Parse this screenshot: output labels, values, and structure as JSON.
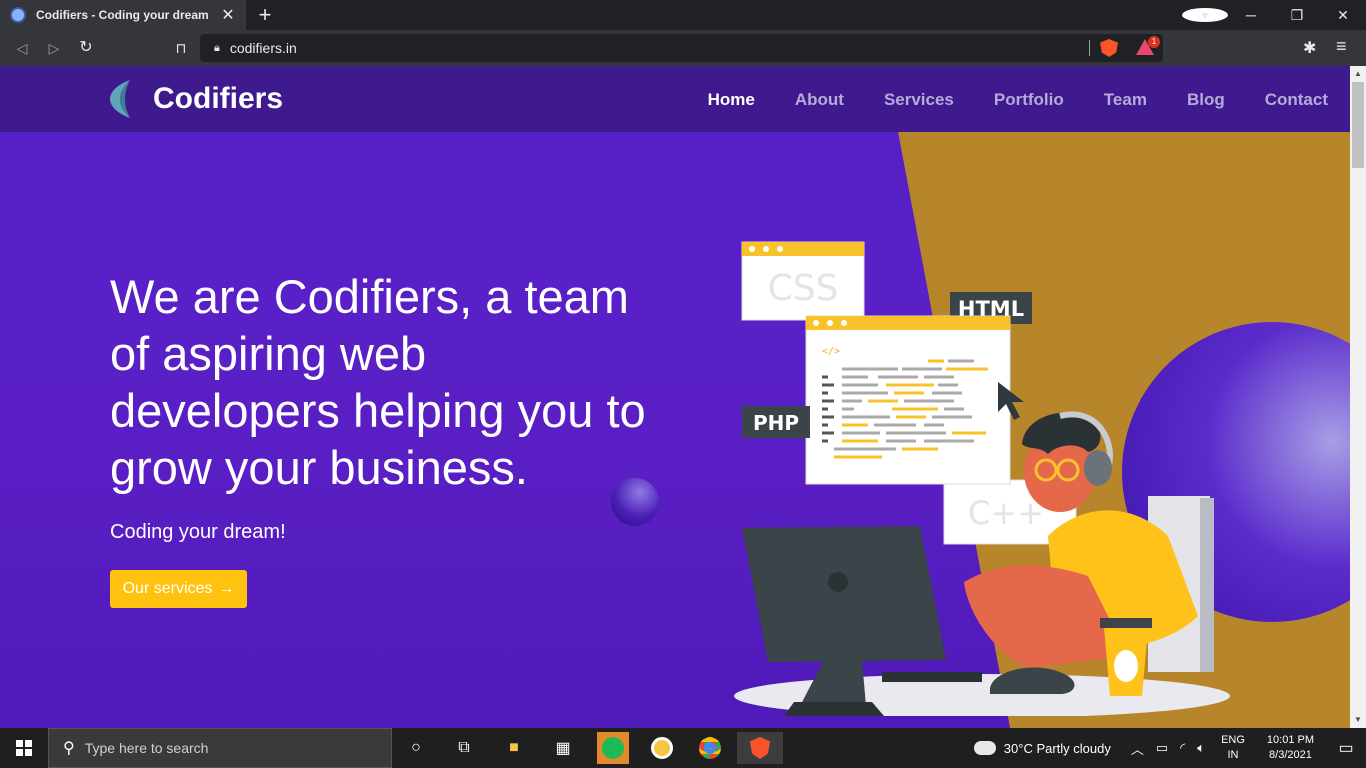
{
  "browser": {
    "tab_title": "Codifiers - Coding your dream",
    "tab_close": "✕",
    "new_tab": "+",
    "url": "codifiers.in",
    "rewards_count": "1",
    "window_minimize": "─",
    "window_restore": "❐",
    "window_close": "✕"
  },
  "site": {
    "brand": "Codifiers",
    "nav": [
      {
        "label": "Home",
        "active": true
      },
      {
        "label": "About",
        "active": false
      },
      {
        "label": "Services",
        "active": false
      },
      {
        "label": "Portfolio",
        "active": false
      },
      {
        "label": "Team",
        "active": false
      },
      {
        "label": "Blog",
        "active": false
      },
      {
        "label": "Contact",
        "active": false
      }
    ],
    "headline": "We are Codifiers, a team of aspiring web developers helping you to grow your business.",
    "tagline": "Coding your dream!",
    "cta_label": "Our services",
    "cta_arrow": "→",
    "illustration_labels": {
      "css": "CSS",
      "html": "HTML",
      "php": "PHP",
      "cpp": "C++",
      "code_tag": "</>"
    },
    "colors": {
      "purple": "#5621c8",
      "nav": "#3f1a8e",
      "gold": "#b7862b",
      "cta": "#ffc20e"
    }
  },
  "taskbar": {
    "search_placeholder": "Type here to search",
    "weather": "30°C  Partly cloudy",
    "lang_top": "ENG",
    "lang_bottom": "IN",
    "time": "10:01 PM",
    "date": "8/3/2021",
    "icons": [
      "start-icon",
      "search-icon",
      "cortana-icon",
      "task-view-icon",
      "file-explorer-icon",
      "store-icon",
      "spotify-icon",
      "vpn-icon",
      "chrome-icon",
      "brave-icon",
      "notification-icon"
    ]
  }
}
